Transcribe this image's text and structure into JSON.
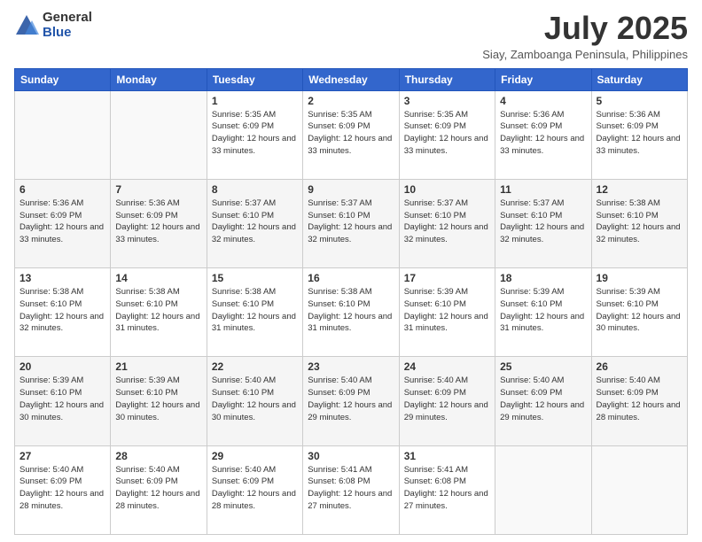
{
  "logo": {
    "general": "General",
    "blue": "Blue"
  },
  "title": {
    "month_year": "July 2025",
    "location": "Siay, Zamboanga Peninsula, Philippines"
  },
  "days_of_week": [
    "Sunday",
    "Monday",
    "Tuesday",
    "Wednesday",
    "Thursday",
    "Friday",
    "Saturday"
  ],
  "weeks": [
    [
      {
        "day": "",
        "info": ""
      },
      {
        "day": "",
        "info": ""
      },
      {
        "day": "1",
        "info": "Sunrise: 5:35 AM\nSunset: 6:09 PM\nDaylight: 12 hours and 33 minutes."
      },
      {
        "day": "2",
        "info": "Sunrise: 5:35 AM\nSunset: 6:09 PM\nDaylight: 12 hours and 33 minutes."
      },
      {
        "day": "3",
        "info": "Sunrise: 5:35 AM\nSunset: 6:09 PM\nDaylight: 12 hours and 33 minutes."
      },
      {
        "day": "4",
        "info": "Sunrise: 5:36 AM\nSunset: 6:09 PM\nDaylight: 12 hours and 33 minutes."
      },
      {
        "day": "5",
        "info": "Sunrise: 5:36 AM\nSunset: 6:09 PM\nDaylight: 12 hours and 33 minutes."
      }
    ],
    [
      {
        "day": "6",
        "info": "Sunrise: 5:36 AM\nSunset: 6:09 PM\nDaylight: 12 hours and 33 minutes."
      },
      {
        "day": "7",
        "info": "Sunrise: 5:36 AM\nSunset: 6:09 PM\nDaylight: 12 hours and 33 minutes."
      },
      {
        "day": "8",
        "info": "Sunrise: 5:37 AM\nSunset: 6:10 PM\nDaylight: 12 hours and 32 minutes."
      },
      {
        "day": "9",
        "info": "Sunrise: 5:37 AM\nSunset: 6:10 PM\nDaylight: 12 hours and 32 minutes."
      },
      {
        "day": "10",
        "info": "Sunrise: 5:37 AM\nSunset: 6:10 PM\nDaylight: 12 hours and 32 minutes."
      },
      {
        "day": "11",
        "info": "Sunrise: 5:37 AM\nSunset: 6:10 PM\nDaylight: 12 hours and 32 minutes."
      },
      {
        "day": "12",
        "info": "Sunrise: 5:38 AM\nSunset: 6:10 PM\nDaylight: 12 hours and 32 minutes."
      }
    ],
    [
      {
        "day": "13",
        "info": "Sunrise: 5:38 AM\nSunset: 6:10 PM\nDaylight: 12 hours and 32 minutes."
      },
      {
        "day": "14",
        "info": "Sunrise: 5:38 AM\nSunset: 6:10 PM\nDaylight: 12 hours and 31 minutes."
      },
      {
        "day": "15",
        "info": "Sunrise: 5:38 AM\nSunset: 6:10 PM\nDaylight: 12 hours and 31 minutes."
      },
      {
        "day": "16",
        "info": "Sunrise: 5:38 AM\nSunset: 6:10 PM\nDaylight: 12 hours and 31 minutes."
      },
      {
        "day": "17",
        "info": "Sunrise: 5:39 AM\nSunset: 6:10 PM\nDaylight: 12 hours and 31 minutes."
      },
      {
        "day": "18",
        "info": "Sunrise: 5:39 AM\nSunset: 6:10 PM\nDaylight: 12 hours and 31 minutes."
      },
      {
        "day": "19",
        "info": "Sunrise: 5:39 AM\nSunset: 6:10 PM\nDaylight: 12 hours and 30 minutes."
      }
    ],
    [
      {
        "day": "20",
        "info": "Sunrise: 5:39 AM\nSunset: 6:10 PM\nDaylight: 12 hours and 30 minutes."
      },
      {
        "day": "21",
        "info": "Sunrise: 5:39 AM\nSunset: 6:10 PM\nDaylight: 12 hours and 30 minutes."
      },
      {
        "day": "22",
        "info": "Sunrise: 5:40 AM\nSunset: 6:10 PM\nDaylight: 12 hours and 30 minutes."
      },
      {
        "day": "23",
        "info": "Sunrise: 5:40 AM\nSunset: 6:09 PM\nDaylight: 12 hours and 29 minutes."
      },
      {
        "day": "24",
        "info": "Sunrise: 5:40 AM\nSunset: 6:09 PM\nDaylight: 12 hours and 29 minutes."
      },
      {
        "day": "25",
        "info": "Sunrise: 5:40 AM\nSunset: 6:09 PM\nDaylight: 12 hours and 29 minutes."
      },
      {
        "day": "26",
        "info": "Sunrise: 5:40 AM\nSunset: 6:09 PM\nDaylight: 12 hours and 28 minutes."
      }
    ],
    [
      {
        "day": "27",
        "info": "Sunrise: 5:40 AM\nSunset: 6:09 PM\nDaylight: 12 hours and 28 minutes."
      },
      {
        "day": "28",
        "info": "Sunrise: 5:40 AM\nSunset: 6:09 PM\nDaylight: 12 hours and 28 minutes."
      },
      {
        "day": "29",
        "info": "Sunrise: 5:40 AM\nSunset: 6:09 PM\nDaylight: 12 hours and 28 minutes."
      },
      {
        "day": "30",
        "info": "Sunrise: 5:41 AM\nSunset: 6:08 PM\nDaylight: 12 hours and 27 minutes."
      },
      {
        "day": "31",
        "info": "Sunrise: 5:41 AM\nSunset: 6:08 PM\nDaylight: 12 hours and 27 minutes."
      },
      {
        "day": "",
        "info": ""
      },
      {
        "day": "",
        "info": ""
      }
    ]
  ]
}
